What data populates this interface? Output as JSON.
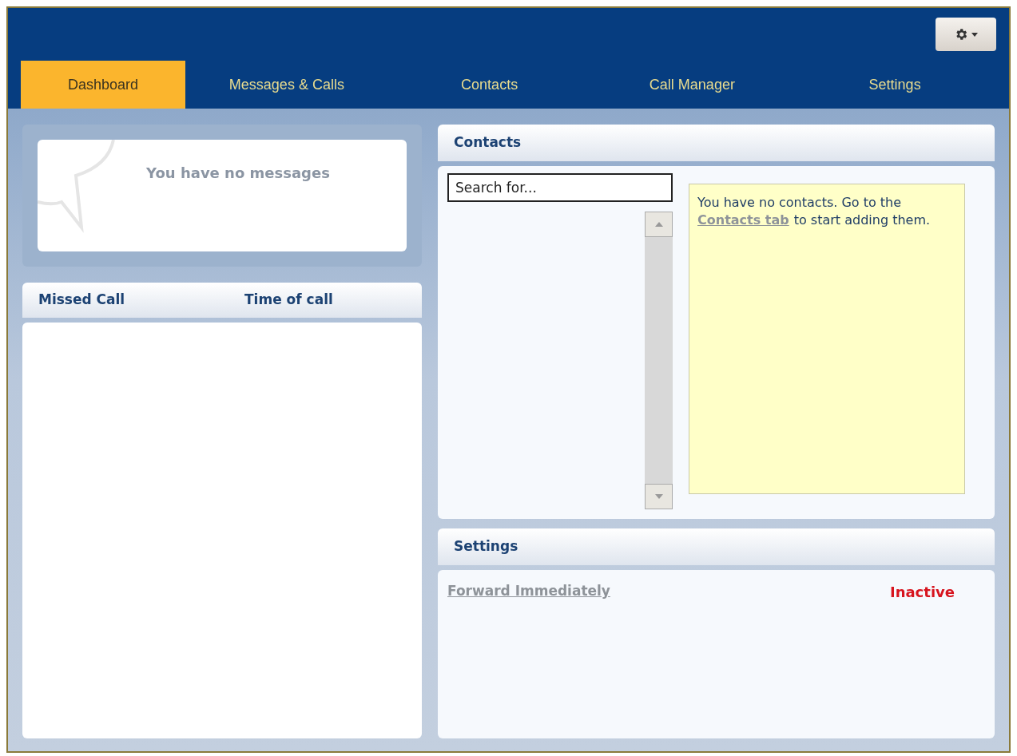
{
  "nav": {
    "tabs": [
      {
        "label": "Dashboard",
        "selected": true
      },
      {
        "label": "Messages & Calls",
        "selected": false
      },
      {
        "label": "Contacts",
        "selected": false
      },
      {
        "label": "Call Manager",
        "selected": false
      },
      {
        "label": "Settings",
        "selected": false
      }
    ]
  },
  "messages": {
    "empty_text": "You have no messages"
  },
  "missed_calls": {
    "columns": [
      "Missed Call",
      "Time of call"
    ]
  },
  "contacts": {
    "title": "Contacts",
    "search": {
      "placeholder": "Search for..."
    },
    "notice": {
      "before": "You have no contacts. Go to the",
      "link": "Contacts tab",
      "after": "to start adding them."
    }
  },
  "settings": {
    "title": "Settings",
    "rows": [
      {
        "label": "Forward Immediately",
        "status": "Inactive",
        "active": false
      }
    ]
  }
}
